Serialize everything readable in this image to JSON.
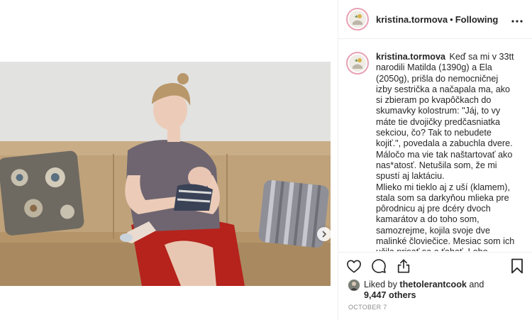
{
  "post": {
    "author": "kristina.tormova",
    "separator": "•",
    "follow_status": "Following",
    "caption_username": "kristina.tormova",
    "caption": "Keď sa mi v 33tt narodili Matilda (1390g) a Ela (2050g), prišla do nemocničnej izby sestrička a načapala ma, ako si zbieram po kvapôčkach do skumavky kolostrum: \"Jáj, to vy máte tie dvojičky predčasniatka sekciou, čo? Tak to nebudete kojiť.\", povedala a zabuchla dvere. Máločo ma vie tak naštartovať ako nas*atosť. Netušila som, že mi spustí aj laktáciu.\nMlieko mi tieklo aj z uší (klamem), stala som sa darkyňou mlieka pre pôrodnicu aj pre dcéry dvoch kamarátov a do toho som, samozrejme, kojila svoje dve malinké človiečice. Mesiac som ich učila prisať sa a ťahať. Lebo nevládali, papali cez hadičky v nose. Boli také maličké, že moje menobradavky boli pre ne"
  },
  "likes": {
    "prefix": "Liked by",
    "liker": "thetolerantcook",
    "conjunction": "and",
    "others": "9,447 others"
  },
  "date": "OCTOBER 7",
  "icons": {
    "like": "heart-icon",
    "comment": "comment-bubble-icon",
    "share": "share-icon",
    "save": "bookmark-icon",
    "more": "more-options-icon",
    "next": "chevron-right-icon"
  },
  "colors": {
    "text": "#262626",
    "muted": "#8e8e8e",
    "border": "#efefef",
    "story_ring": "#e8a1b4"
  }
}
